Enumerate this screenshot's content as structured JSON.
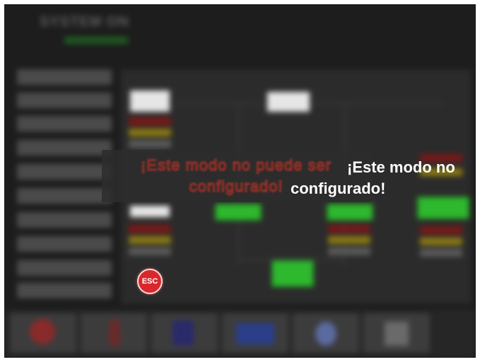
{
  "background": {
    "title": "SYSTEM ON",
    "subtitle": ""
  },
  "message": {
    "blurred_text": "¡Este modo no puede ser configurado!",
    "line1": "¡Este modo no",
    "line2": "configurado!",
    "color": "#ffffff",
    "shadow_color": "#c0392b"
  },
  "esc_button": {
    "label": "ESC",
    "color": "#d9282c"
  },
  "bottom_bar": {
    "right_text": ""
  }
}
